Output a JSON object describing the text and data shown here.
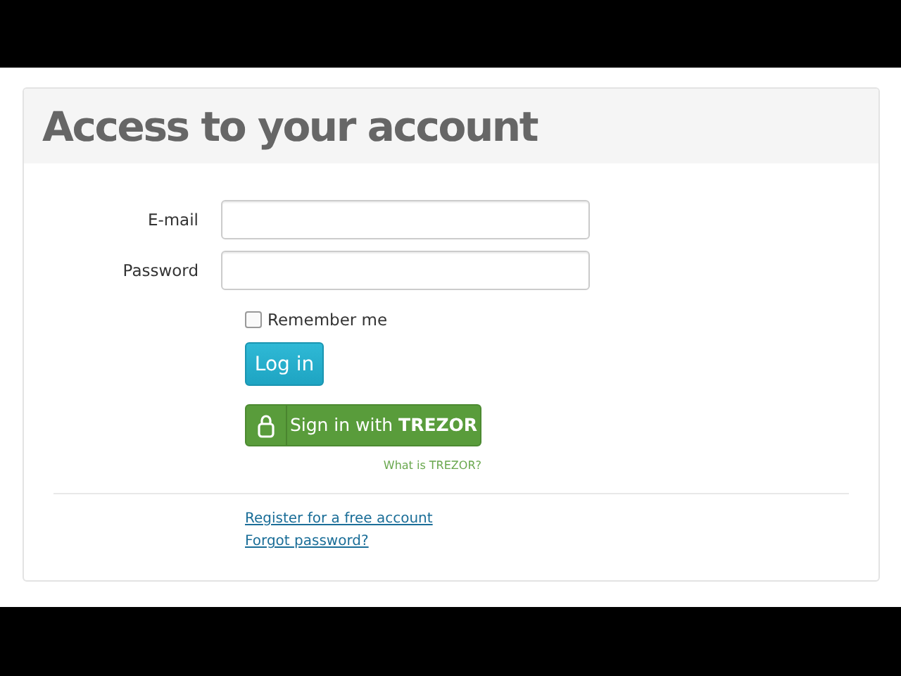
{
  "panel": {
    "title": "Access to your account"
  },
  "fields": [
    {
      "label": "E-mail"
    },
    {
      "label": "Password"
    }
  ],
  "remember": {
    "label": "Remember me",
    "checked": false
  },
  "login_button": "Log in",
  "trezor": {
    "button": "Sign in with **TREZOR**",
    "help_link": "What is TREZOR?"
  },
  "links": [
    "Register for a free account",
    "Forgot password?"
  ]
}
